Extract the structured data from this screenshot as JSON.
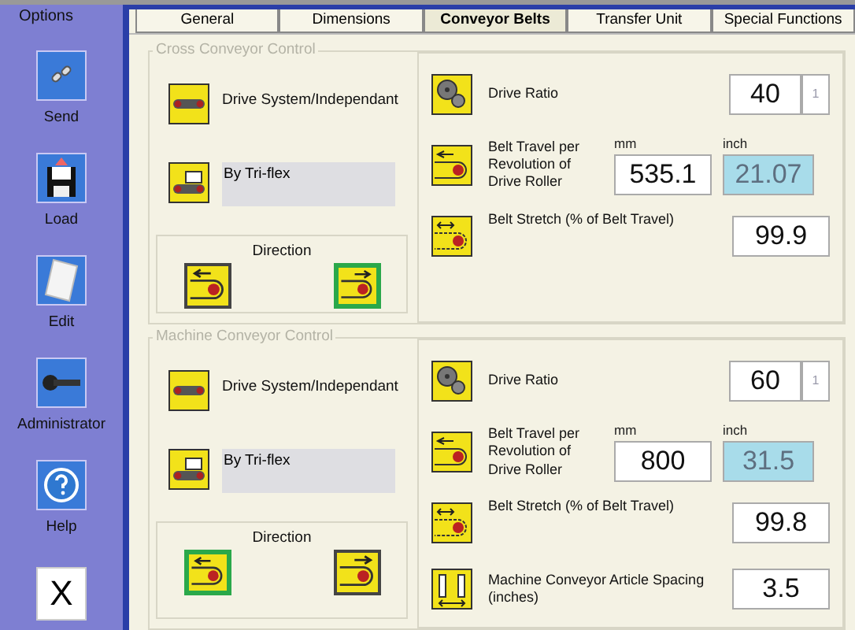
{
  "sidebar": {
    "title": "Options",
    "items": [
      {
        "kind": "send",
        "label": "Send"
      },
      {
        "kind": "load",
        "label": "Load"
      },
      {
        "kind": "edit",
        "label": "Edit"
      },
      {
        "kind": "admin",
        "label": "Administrator"
      },
      {
        "kind": "help",
        "label": "Help"
      },
      {
        "kind": "close",
        "glyph": "X"
      }
    ]
  },
  "tabs": [
    {
      "label": "General",
      "selected": false
    },
    {
      "label": "Dimensions",
      "selected": false
    },
    {
      "label": "Conveyor Belts",
      "selected": true
    },
    {
      "label": "Transfer Unit",
      "selected": false
    },
    {
      "label": "Special Functions",
      "selected": false
    }
  ],
  "sections": [
    {
      "title": "Cross Conveyor Control",
      "drive_system": "Drive System/Independant",
      "tri_flex": "By Tri-flex",
      "direction": {
        "label": "Direction",
        "buttons": [
          {
            "kind": "left",
            "selected": false
          },
          {
            "kind": "right",
            "selected": true
          }
        ]
      },
      "params": [
        {
          "kind": "ratio",
          "label": "Drive Ratio",
          "value": "40",
          "suffix": "1"
        },
        {
          "kind": "travel",
          "label": "Belt Travel per Revolution of Drive Roller",
          "unit_mm": "mm",
          "unit_inch": "inch",
          "value": "535.1",
          "inch_value": "21.07",
          "inch_disabled": true
        },
        {
          "kind": "stretch",
          "label": "Belt Stretch (% of Belt Travel)",
          "value": "99.9"
        }
      ]
    },
    {
      "title": "Machine Conveyor Control",
      "drive_system": "Drive System/Independant",
      "tri_flex": "By Tri-flex",
      "direction": {
        "label": "Direction",
        "buttons": [
          {
            "kind": "left",
            "selected": true
          },
          {
            "kind": "right",
            "selected": false
          }
        ]
      },
      "params": [
        {
          "kind": "ratio",
          "label": "Drive Ratio",
          "value": "60",
          "suffix": "1"
        },
        {
          "kind": "travel",
          "label": "Belt Travel per Revolution of Drive Roller",
          "unit_mm": "mm",
          "unit_inch": "inch",
          "value": "800",
          "inch_value": "31.5",
          "inch_disabled": true
        },
        {
          "kind": "stretch",
          "label": "Belt Stretch (% of Belt Travel)",
          "value": "99.8"
        },
        {
          "kind": "spacing",
          "label": "Machine Conveyor Article Spacing (inches)",
          "value": "3.5"
        }
      ]
    }
  ]
}
